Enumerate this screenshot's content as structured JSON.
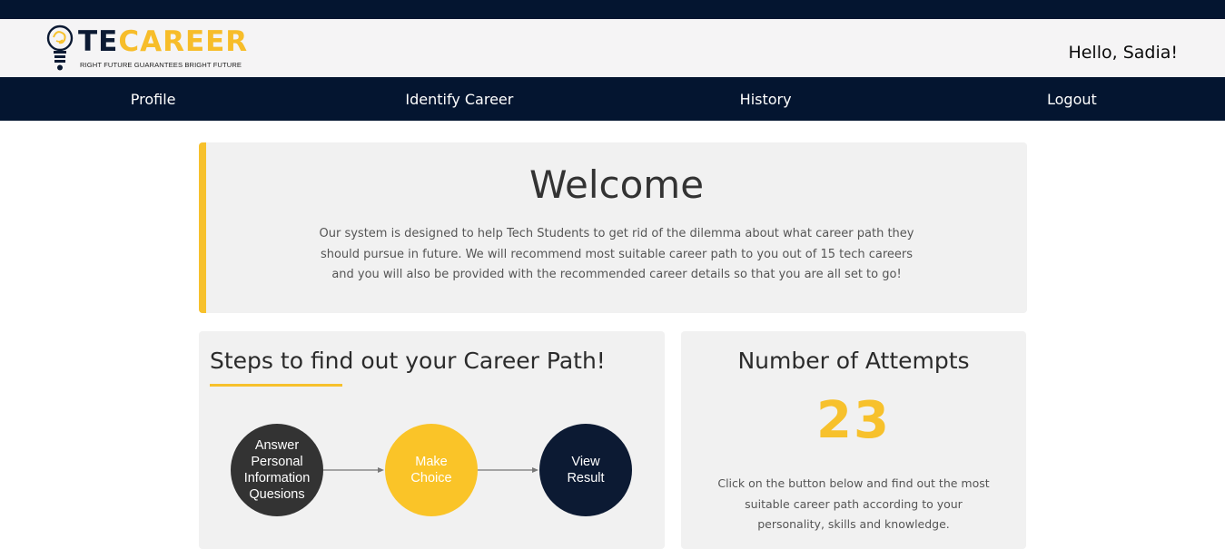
{
  "brand": {
    "name_part1": "TE",
    "name_part2": "CAREER",
    "tagline": "RIGHT FUTURE GUARANTEES BRIGHT FUTURE",
    "colors": {
      "navy": "#041530",
      "yellow": "#f7c12c"
    }
  },
  "header": {
    "greeting": "Hello, Sadia!"
  },
  "nav": {
    "items": [
      {
        "label": "Profile"
      },
      {
        "label": "Identify Career"
      },
      {
        "label": "History"
      },
      {
        "label": "Logout"
      }
    ]
  },
  "welcome": {
    "title": "Welcome",
    "description": "Our system is designed to help Tech Students to get rid of the dilemma about what career path they should pursue in future. We will recommend most suitable career path to you out of 15 tech careers and you will also be provided with the recommended career details so that you are all set to go!"
  },
  "steps": {
    "title": "Steps to find out your Career Path!",
    "items": [
      {
        "label": "Answer Personal Information Quesions",
        "lines": [
          "Answer",
          "Personal",
          "Information",
          "Quesions"
        ]
      },
      {
        "label": "Make Choice",
        "lines": [
          "Make",
          "Choice"
        ]
      },
      {
        "label": "View Result",
        "lines": [
          "View",
          "Result"
        ]
      }
    ]
  },
  "attempts": {
    "title": "Number of Attempts",
    "count": "23",
    "description": "Click on the button below and find out the most suitable career path according to your personality, skills and knowledge."
  }
}
